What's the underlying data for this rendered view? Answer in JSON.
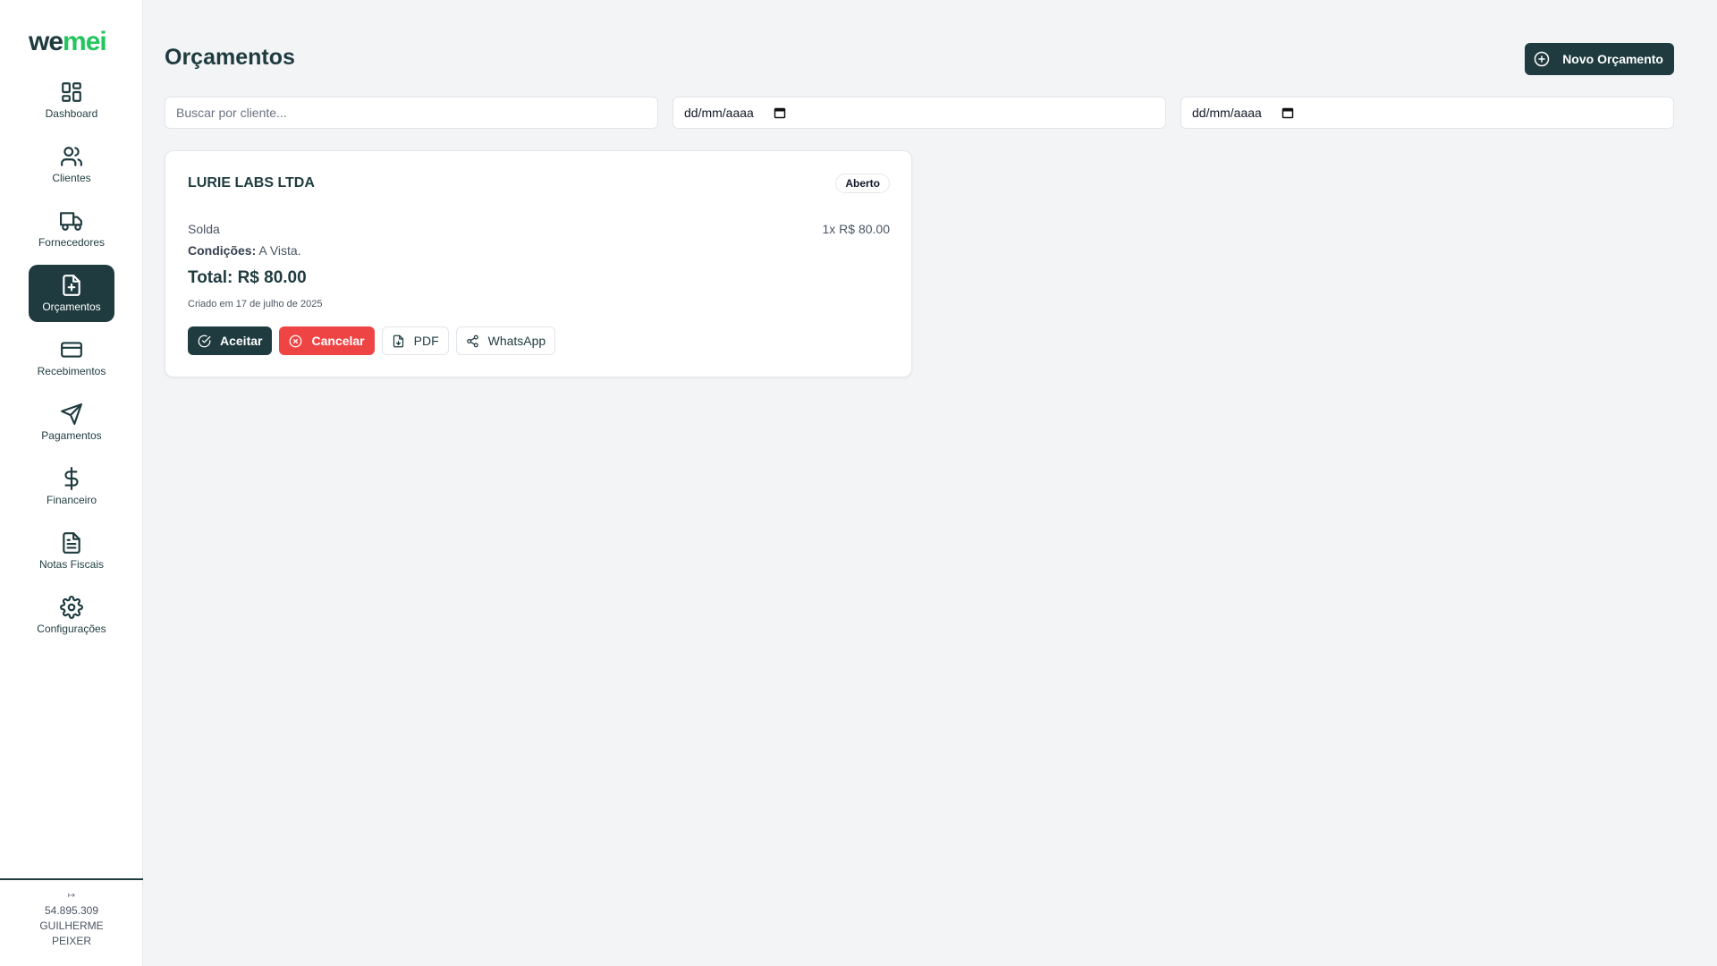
{
  "app": {
    "logo_we": "we",
    "logo_mei": "mei",
    "brand_color": "#1f3b3f",
    "accent_color": "#22c55e"
  },
  "sidebar": {
    "items": [
      {
        "label": "Dashboard",
        "icon": "dashboard-icon",
        "active": false
      },
      {
        "label": "Clientes",
        "icon": "users-icon",
        "active": false
      },
      {
        "label": "Fornecedores",
        "icon": "truck-icon",
        "active": false
      },
      {
        "label": "Orçamentos",
        "icon": "file-plus-icon",
        "active": true
      },
      {
        "label": "Recebimentos",
        "icon": "credit-card-icon",
        "active": false
      },
      {
        "label": "Pagamentos",
        "icon": "send-icon",
        "active": false
      },
      {
        "label": "Financeiro",
        "icon": "dollar-icon",
        "active": false
      },
      {
        "label": "Notas Fiscais",
        "icon": "file-text-icon",
        "active": false
      },
      {
        "label": "Configurações",
        "icon": "gear-icon",
        "active": false
      }
    ],
    "footer": {
      "logout_icon": "↦",
      "line1": "54.895.309",
      "line2": "GUILHERME",
      "line3": "PEIXER"
    }
  },
  "header": {
    "title": "Orçamentos",
    "new_button": "Novo Orçamento"
  },
  "filters": {
    "search_placeholder": "Buscar por cliente...",
    "date_from": "dd/mm/aaaa",
    "date_to": "dd/mm/aaaa"
  },
  "quotes": [
    {
      "client": "LURIE LABS LTDA",
      "status": "Aberto",
      "item_name": "Solda",
      "item_value": "1x R$ 80.00",
      "conditions_label": "Condições:",
      "conditions_value": "A Vista.",
      "total": "Total: R$ 80.00",
      "created": "Criado em 17 de julho de 2025",
      "actions": {
        "accept": "Aceitar",
        "cancel": "Cancelar",
        "pdf": "PDF",
        "whatsapp": "WhatsApp"
      }
    }
  ]
}
